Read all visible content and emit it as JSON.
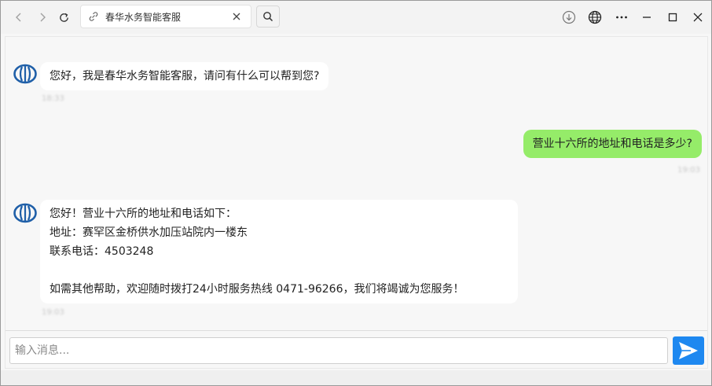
{
  "browser": {
    "tab_title": "春华水务智能客服"
  },
  "chat": {
    "messages": [
      {
        "role": "bot",
        "lines": [
          "您好，我是春华水务智能客服，请问有什么可以帮到您?"
        ],
        "time": "18:33"
      },
      {
        "role": "user",
        "lines": [
          "营业十六所的地址和电话是多少?"
        ],
        "time": "19:03"
      },
      {
        "role": "bot",
        "lines": [
          "您好！营业十六所的地址和电话如下：",
          "地址：赛罕区金桥供水加压站院内一楼东",
          "联系电话：4503248",
          "",
          "如需其他帮助，欢迎随时拨打24小时服务热线 0471-96266，我们将竭诚为您服务！"
        ],
        "time": "19:03"
      }
    ]
  },
  "composer": {
    "placeholder": "输入消息..."
  },
  "colors": {
    "user_bubble": "#95ec69",
    "bot_bubble": "#ffffff",
    "send_button": "#1e88f0",
    "logo": "#1f5fa8"
  },
  "icons": {
    "back": "arrow-left-icon",
    "forward": "arrow-right-icon",
    "refresh": "refresh-icon",
    "link": "link-icon",
    "close": "close-icon",
    "search": "search-icon",
    "download": "download-icon",
    "globe": "globe-icon",
    "more": "more-icon",
    "minimize": "minimize-icon",
    "maximize": "maximize-icon",
    "window_close": "window-close-icon",
    "send": "send-icon",
    "avatar": "water-logo-icon"
  }
}
